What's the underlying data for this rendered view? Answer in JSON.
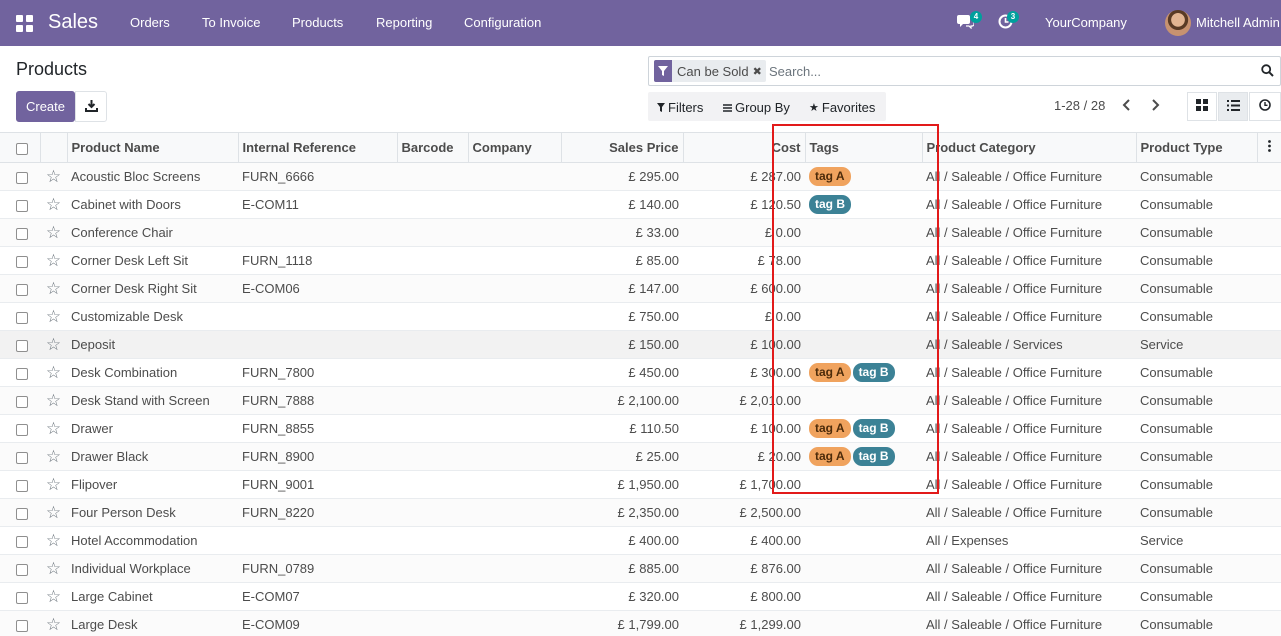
{
  "navbar": {
    "app_name": "Sales",
    "menu": [
      "Orders",
      "To Invoice",
      "Products",
      "Reporting",
      "Configuration"
    ],
    "messages_badge": "4",
    "activities_badge": "3",
    "company": "YourCompany",
    "user": "Mitchell Admin",
    "colors": {
      "bar": "#71639e",
      "badge": "#00a09d"
    }
  },
  "page": {
    "title": "Products"
  },
  "toolbar": {
    "create_label": "Create",
    "download_icon": "download-icon"
  },
  "search": {
    "facet_label": "Can be Sold",
    "facet_icon": "filter-icon",
    "placeholder": "Search...",
    "filters_label": "Filters",
    "groupby_label": "Group By",
    "favorites_label": "Favorites"
  },
  "pager": {
    "value": "1-28 / 28"
  },
  "views": [
    "kanban",
    "list",
    "activity"
  ],
  "table": {
    "headers": {
      "name": "Product Name",
      "ref": "Internal Reference",
      "barcode": "Barcode",
      "company": "Company",
      "price": "Sales Price",
      "cost": "Cost",
      "tags": "Tags",
      "category": "Product Category",
      "type": "Product Type"
    },
    "tag_colors": {
      "tag A": "#f0a35e",
      "tag B": "#3c8296"
    },
    "rows": [
      {
        "name": "Acoustic Bloc Screens",
        "ref": "FURN_6666",
        "price": "£ 295.00",
        "cost": "£ 287.00",
        "tags": [
          "tag A"
        ],
        "category": "All / Saleable / Office Furniture",
        "type": "Consumable"
      },
      {
        "name": "Cabinet with Doors",
        "ref": "E-COM11",
        "price": "£ 140.00",
        "cost": "£ 120.50",
        "tags": [
          "tag B"
        ],
        "category": "All / Saleable / Office Furniture",
        "type": "Consumable"
      },
      {
        "name": "Conference Chair",
        "ref": "",
        "price": "£ 33.00",
        "cost": "£ 0.00",
        "tags": [],
        "category": "All / Saleable / Office Furniture",
        "type": "Consumable"
      },
      {
        "name": "Corner Desk Left Sit",
        "ref": "FURN_1118",
        "price": "£ 85.00",
        "cost": "£ 78.00",
        "tags": [],
        "category": "All / Saleable / Office Furniture",
        "type": "Consumable"
      },
      {
        "name": "Corner Desk Right Sit",
        "ref": "E-COM06",
        "price": "£ 147.00",
        "cost": "£ 600.00",
        "tags": [],
        "category": "All / Saleable / Office Furniture",
        "type": "Consumable"
      },
      {
        "name": "Customizable Desk",
        "ref": "",
        "price": "£ 750.00",
        "cost": "£ 0.00",
        "tags": [],
        "category": "All / Saleable / Office Furniture",
        "type": "Consumable"
      },
      {
        "name": "Deposit",
        "ref": "",
        "price": "£ 150.00",
        "cost": "£ 100.00",
        "tags": [],
        "category": "All / Saleable / Services",
        "type": "Service"
      },
      {
        "name": "Desk Combination",
        "ref": "FURN_7800",
        "price": "£ 450.00",
        "cost": "£ 300.00",
        "tags": [
          "tag A",
          "tag B"
        ],
        "category": "All / Saleable / Office Furniture",
        "type": "Consumable"
      },
      {
        "name": "Desk Stand with Screen",
        "ref": "FURN_7888",
        "price": "£ 2,100.00",
        "cost": "£ 2,010.00",
        "tags": [],
        "category": "All / Saleable / Office Furniture",
        "type": "Consumable"
      },
      {
        "name": "Drawer",
        "ref": "FURN_8855",
        "price": "£ 110.50",
        "cost": "£ 100.00",
        "tags": [
          "tag A",
          "tag B"
        ],
        "category": "All / Saleable / Office Furniture",
        "type": "Consumable"
      },
      {
        "name": "Drawer Black",
        "ref": "FURN_8900",
        "price": "£ 25.00",
        "cost": "£ 20.00",
        "tags": [
          "tag A",
          "tag B"
        ],
        "category": "All / Saleable / Office Furniture",
        "type": "Consumable"
      },
      {
        "name": "Flipover",
        "ref": "FURN_9001",
        "price": "£ 1,950.00",
        "cost": "£ 1,700.00",
        "tags": [],
        "category": "All / Saleable / Office Furniture",
        "type": "Consumable"
      },
      {
        "name": "Four Person Desk",
        "ref": "FURN_8220",
        "price": "£ 2,350.00",
        "cost": "£ 2,500.00",
        "tags": [],
        "category": "All / Saleable / Office Furniture",
        "type": "Consumable"
      },
      {
        "name": "Hotel Accommodation",
        "ref": "",
        "price": "£ 400.00",
        "cost": "£ 400.00",
        "tags": [],
        "category": "All / Expenses",
        "type": "Service"
      },
      {
        "name": "Individual Workplace",
        "ref": "FURN_0789",
        "price": "£ 885.00",
        "cost": "£ 876.00",
        "tags": [],
        "category": "All / Saleable / Office Furniture",
        "type": "Consumable"
      },
      {
        "name": "Large Cabinet",
        "ref": "E-COM07",
        "price": "£ 320.00",
        "cost": "£ 800.00",
        "tags": [],
        "category": "All / Saleable / Office Furniture",
        "type": "Consumable"
      },
      {
        "name": "Large Desk",
        "ref": "E-COM09",
        "price": "£ 1,799.00",
        "cost": "£ 1,299.00",
        "tags": [],
        "category": "All / Saleable / Office Furniture",
        "type": "Consumable"
      }
    ]
  },
  "annotation": {
    "color": "#e21a1a"
  }
}
